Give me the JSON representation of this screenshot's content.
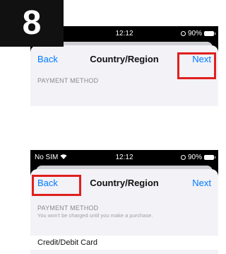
{
  "step_number": "8",
  "colors": {
    "accent": "#007aff",
    "highlight": "#e0201f",
    "sheet_bg": "#f2f2f7"
  },
  "top_phone": {
    "status": {
      "time": "12:12",
      "battery": "90%"
    },
    "nav": {
      "back": "Back",
      "title": "Country/Region",
      "next": "Next"
    },
    "section_header": "PAYMENT METHOD",
    "highlighted": "next-button"
  },
  "bottom_phone": {
    "status": {
      "carrier": "No SIM",
      "time": "12:12",
      "battery": "90%"
    },
    "nav": {
      "back": "Back",
      "title": "Country/Region",
      "next": "Next"
    },
    "section_header": "PAYMENT METHOD",
    "section_subtext": "You won't be charged until you make a purchase.",
    "rows": [
      {
        "label": "Credit/Debit Card"
      }
    ],
    "highlighted": "back-button"
  }
}
